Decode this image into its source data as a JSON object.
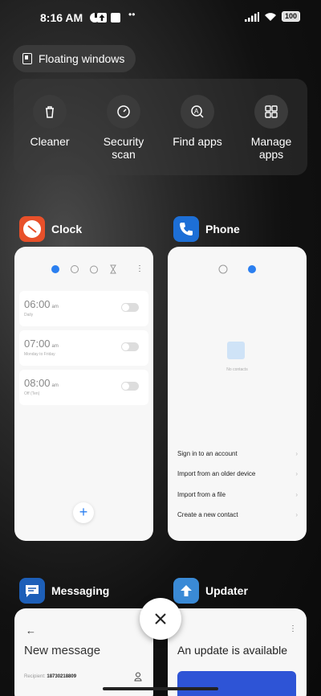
{
  "status": {
    "time": "8:16 AM",
    "battery": "100"
  },
  "floating": {
    "label": "Floating windows"
  },
  "tools": [
    {
      "label": "Cleaner",
      "icon": "trash-icon"
    },
    {
      "label": "Security\nscan",
      "icon": "shield-gauge-icon"
    },
    {
      "label": "Find apps",
      "icon": "search-apps-icon"
    },
    {
      "label": "Manage\napps",
      "icon": "grid-icon"
    }
  ],
  "apps": {
    "clock": {
      "name": "Clock",
      "alarms": [
        {
          "time": "06:00",
          "ampm": "am",
          "sub": "Daily"
        },
        {
          "time": "07:00",
          "ampm": "am",
          "sub": "Monday to Friday"
        },
        {
          "time": "08:00",
          "ampm": "am",
          "sub": "Off (Ten)"
        }
      ],
      "add": "+"
    },
    "phone": {
      "name": "Phone",
      "empty": "No contacts",
      "links": [
        "Sign in to an account",
        "Import from an older device",
        "Import from a file",
        "Create a new contact"
      ]
    },
    "messaging": {
      "name": "Messaging",
      "back": "←",
      "title": "New message",
      "recipient_label": "Recipient:",
      "recipient_value": "18730218809"
    },
    "updater": {
      "name": "Updater",
      "title": "An update is available",
      "menu": "⋮"
    }
  },
  "colors": {
    "accent": "#2b7ff0",
    "clock_icon": "#e8502a",
    "phone_icon": "#1d6fd6",
    "messaging_icon": "#1d5fb8",
    "updater_icon": "#3a8ad6"
  }
}
